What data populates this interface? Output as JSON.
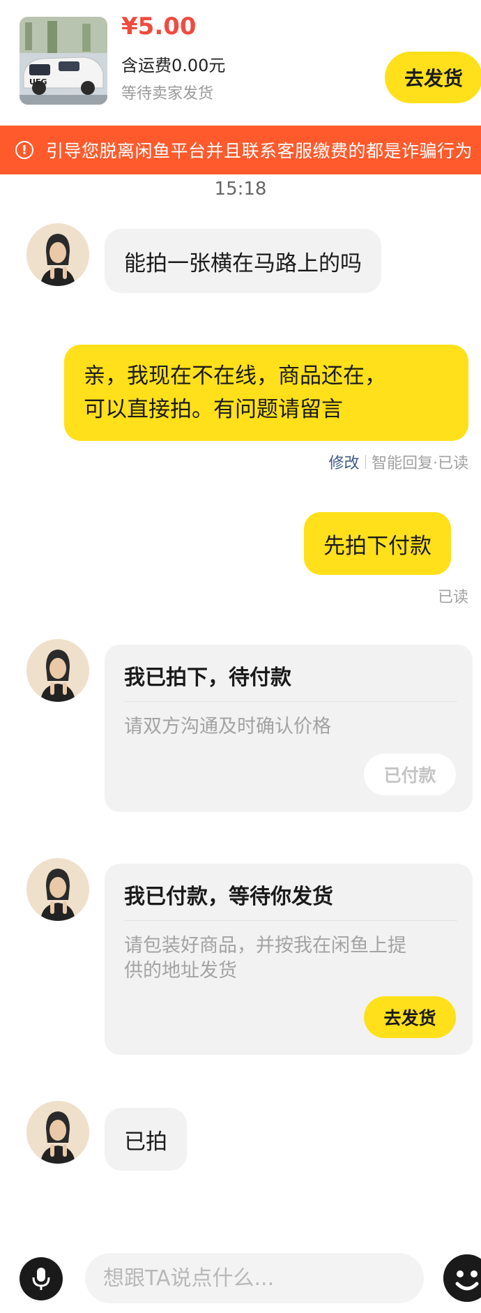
{
  "product": {
    "price": "¥5.00",
    "shipping": "含运费0.00元",
    "status": "等待卖家发货",
    "ship_button": "去发货",
    "thumb_badge": "UEG"
  },
  "warning": {
    "icon": "!",
    "text": "引导您脱离闲鱼平台并且联系客服缴费的都是诈骗行为"
  },
  "chat": {
    "timestamp": "15:18",
    "messages": [
      {
        "text": "能拍一张横在马路上的吗"
      },
      {
        "line1": "亲，我现在不在线，商品还在，",
        "line2": "可以直接拍。有问题请留言"
      },
      {
        "text": "先拍下付款"
      },
      {
        "text": "已拍"
      }
    ],
    "meta_auto": {
      "edit": "修改",
      "label": "智能回复·已读"
    },
    "meta_read": "已读",
    "cards": [
      {
        "title": "我已拍下，待付款",
        "desc": "请双方沟通及时确认价格",
        "button": "已付款"
      },
      {
        "title": "我已付款，等待你发货",
        "desc_line1": "请包装好商品，并按我在闲鱼上提",
        "desc_line2": "供的地址发货",
        "button": "去发货"
      }
    ]
  },
  "input": {
    "placeholder": "想跟TA说点什么..."
  },
  "colors": {
    "accent_yellow": "#ffe01a",
    "price_red": "#f04b3e",
    "warning_orange": "#ff5a2c"
  },
  "icons": [
    "warning-icon",
    "microphone-icon",
    "emoji-icon"
  ]
}
